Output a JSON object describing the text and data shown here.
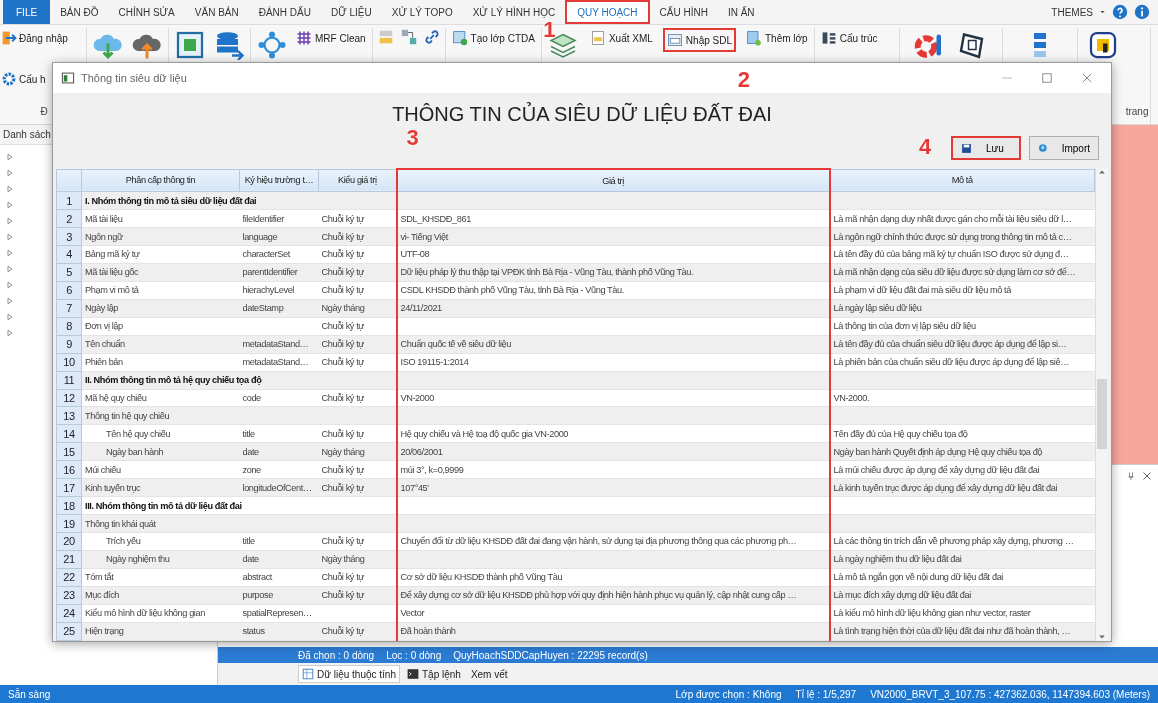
{
  "menu": {
    "tabs": [
      {
        "label": "FILE",
        "kind": "file",
        "selected": false,
        "highlighted": false
      },
      {
        "label": "BẢN ĐỒ",
        "kind": "tab",
        "selected": false,
        "highlighted": false
      },
      {
        "label": "CHỈNH SỬA",
        "kind": "tab",
        "selected": false,
        "highlighted": false
      },
      {
        "label": "VĂN BẢN",
        "kind": "tab",
        "selected": false,
        "highlighted": false
      },
      {
        "label": "ĐÁNH DẤU",
        "kind": "tab",
        "selected": false,
        "highlighted": false
      },
      {
        "label": "DỮ LIỆU",
        "kind": "tab",
        "selected": false,
        "highlighted": false
      },
      {
        "label": "XỬ LÝ TOPO",
        "kind": "tab",
        "selected": false,
        "highlighted": false
      },
      {
        "label": "XỬ LÝ HÌNH HỌC",
        "kind": "tab",
        "selected": false,
        "highlighted": false
      },
      {
        "label": "QUY HOẠCH",
        "kind": "tab",
        "selected": true,
        "highlighted": true,
        "callout": "1"
      },
      {
        "label": "CẤU HÌNH",
        "kind": "tab",
        "selected": false,
        "highlighted": false
      },
      {
        "label": "IN ẤN",
        "kind": "tab",
        "selected": false,
        "highlighted": false
      }
    ],
    "themes": "THEMES"
  },
  "ribbon": {
    "account_buttons": [
      {
        "label": "Đăng nhập"
      },
      {
        "label": "Cấu h"
      }
    ],
    "group_label": "Đ",
    "buttons": [
      {
        "label": "MRF Clean",
        "highlighted": false
      },
      {
        "label": "Tạo lớp CTDA",
        "highlighted": false
      },
      {
        "label": "Xuất XML",
        "highlighted": false
      },
      {
        "label": "Nhập SDL",
        "highlighted": true,
        "callout": "2"
      },
      {
        "label": "Thêm lớp",
        "highlighted": false
      },
      {
        "label": "Cấu trúc",
        "highlighted": false
      }
    ],
    "last_group_label": "trang"
  },
  "left_panel": {
    "title": "Danh sách"
  },
  "dialog": {
    "title": "Thông tin siêu dữ liệu",
    "heading": "THÔNG TIN CỦA SIÊU DỮ LIỆU ĐẤT ĐAI",
    "buttons": [
      {
        "label": "Lưu",
        "kind": "save",
        "highlighted": true,
        "callout": "4"
      },
      {
        "label": "Import",
        "kind": "import",
        "highlighted": false
      }
    ],
    "table": {
      "columns": [
        {
          "label": "Phân cấp thông tin",
          "highlighted": false
        },
        {
          "label": "Ký hiệu trường t…",
          "highlighted": false
        },
        {
          "label": "Kiểu giá trị",
          "highlighted": false
        },
        {
          "label": "Giá trị",
          "highlighted": true,
          "callout": "3"
        },
        {
          "label": "Mô tả",
          "highlighted": false
        }
      ],
      "rows": [
        {
          "number": "1",
          "kind": "group",
          "name": "I. Nhóm thông tin mô tả siêu dữ liệu đất đai"
        },
        {
          "number": "2",
          "kind": "item",
          "name": "Mã tài liệu",
          "field": "fileIdentifier",
          "type": "Chuỗi ký tự",
          "value": "SDL_KHSDĐ_861",
          "description": "Là mã nhận dạng duy nhất được gán cho mỗi tài liệu siêu dữ l…"
        },
        {
          "number": "3",
          "kind": "item",
          "name": "Ngôn ngữ",
          "field": "language",
          "type": "Chuỗi ký tự",
          "value": "vi- Tiếng Việt",
          "description": "Là ngôn ngữ chính thức được sử dụng trong thông tin mô tả c…"
        },
        {
          "number": "4",
          "kind": "item",
          "name": "Bảng mã ký tự",
          "field": "characterSet",
          "type": "Chuỗi ký tự",
          "value": "UTF-08",
          "description": "Là tên đầy đủ của bảng mã ký tự chuẩn ISO được sử dụng đ…"
        },
        {
          "number": "5",
          "kind": "item",
          "name": "Mã tài liệu gốc",
          "field": "parentIdentifier",
          "type": "Chuỗi ký tự",
          "value": "Dữ liệu pháp lý thu thập tại VPĐK tỉnh Bà Rịa - Vũng Tàu, thành phố Vũng Tàu.",
          "description": "Là mã nhận dạng của siêu dữ liệu được sử dụng làm cơ sở để…"
        },
        {
          "number": "6",
          "kind": "item",
          "name": "Phạm vi mô tả",
          "field": "hierachyLevel",
          "type": "Chuỗi ký tự",
          "value": "CSDL KHSDĐ thành phố Vũng Tàu, tỉnh Bà Rịa - Vũng Tàu.",
          "description": "Là phạm vi dữ liệu đất đai mà siêu dữ liệu mô tả"
        },
        {
          "number": "7",
          "kind": "item",
          "name": "Ngày lập",
          "field": "dateStamp",
          "type": "Ngày tháng",
          "value": "24/11/2021",
          "description": "Là ngày lập siêu dữ liệu"
        },
        {
          "number": "8",
          "kind": "item",
          "name": "Đơn vị lập",
          "type": "Chuỗi ký tự",
          "description": "Là thông tin của đơn vị lập siêu dữ liệu"
        },
        {
          "number": "9",
          "kind": "item",
          "name": "Tên chuẩn",
          "field": "metadataStand…",
          "type": "Chuỗi ký tự",
          "value": "Chuẩn quốc tế về siêu dữ liệu",
          "description": "Là tên đầy đủ của chuẩn siêu dữ liệu được áp dụng để lập si…"
        },
        {
          "number": "10",
          "kind": "item",
          "name": "Phiên bản",
          "field": "metadataStand…",
          "type": "Chuỗi ký tự",
          "value": "ISO 19115-1:2014",
          "description": "Là phiên bản của chuẩn siêu dữ liệu được áp dụng để lập siê…"
        },
        {
          "number": "11",
          "kind": "group",
          "name": "II. Nhóm thông tin mô tả hệ quy chiếu tọa độ"
        },
        {
          "number": "12",
          "kind": "item",
          "name": "Mã hệ quy chiếu",
          "field": "code",
          "type": "Chuỗi ký tự",
          "value": "VN-2000",
          "description": "VN-2000."
        },
        {
          "number": "13",
          "kind": "item",
          "name": "Thông tin hệ quy chiếu"
        },
        {
          "number": "14",
          "kind": "subitem",
          "name": "Tên hệ quy chiếu",
          "field": "title",
          "type": "Chuỗi ký tự",
          "value": "Hệ quy chiếu và Hệ toạ độ quốc gia VN-2000",
          "description": "Tên đầy đủ của Hệ quy chiếu tọa độ"
        },
        {
          "number": "15",
          "kind": "subitem",
          "name": "Ngày ban hành",
          "field": "date",
          "type": "Ngày tháng",
          "value": "20/06/2001",
          "description": "Ngày ban hành Quyết định áp dụng Hệ quy chiếu tọa độ"
        },
        {
          "number": "16",
          "kind": "item",
          "name": "Múi chiếu",
          "field": "zone",
          "type": "Chuỗi ký tự",
          "value": "múi 3°, k=0,9999",
          "description": "Là múi chiếu được áp dụng để xây dựng dữ liệu đất đai"
        },
        {
          "number": "17",
          "kind": "item",
          "name": "Kinh tuyến trục",
          "field": "longitudeOfCent…",
          "type": "Chuỗi ký tự",
          "value": "107°45'",
          "description": "Là kinh tuyến trục được áp dụng để xây dựng dữ liệu đất đai"
        },
        {
          "number": "18",
          "kind": "group",
          "name": "III. Nhóm thông tin mô tả dữ liệu đất đai"
        },
        {
          "number": "19",
          "kind": "item",
          "name": "Thông tin khái quát"
        },
        {
          "number": "20",
          "kind": "subitem",
          "name": "Trích yếu",
          "field": "title",
          "type": "Chuỗi ký tự",
          "value": "Chuyển đổi từ dữ liệu KHSDĐ đất đai đang vận hành, sử dụng tại địa phương thông qua các phương ph…",
          "description": "Là các thông tin trích dẫn về phương pháp xây dựng, phương …"
        },
        {
          "number": "21",
          "kind": "subitem",
          "name": "Ngày nghiệm thu",
          "field": "date",
          "type": "Ngày tháng",
          "description": "Là ngày nghiệm thu dữ liệu đất đai"
        },
        {
          "number": "22",
          "kind": "item",
          "name": "Tóm tắt",
          "field": "abstract",
          "type": "Chuỗi ký tự",
          "value": "Cơ sở dữ liệu KHSDĐ thành phố Vũng Tàu",
          "description": "Là mô tả ngắn gọn về nội dung dữ liệu đất đai"
        },
        {
          "number": "23",
          "kind": "item",
          "name": "Mục đích",
          "field": "purpose",
          "type": "Chuỗi ký tự",
          "value": "Để xây dựng cơ sở dữ liệu KHSDĐ phù hợp với quy định hiện hành phục vụ quản lý, cập nhật cung cấp …",
          "description": "Là mục đích xây dựng dữ liệu đất đai"
        },
        {
          "number": "24",
          "kind": "item",
          "name": "Kiểu mô hình dữ liệu không gian",
          "field": "spatialRepresen…",
          "value": "Vector",
          "description": "Là kiểu mô hình dữ liệu không gian như vector, raster"
        },
        {
          "number": "25",
          "kind": "item",
          "name": "Hiện trạng",
          "field": "status",
          "type": "Chuỗi ký tự",
          "value": "Đã hoàn thành",
          "description": "Là tình trạng hiện thời của dữ liệu đất đai như đã hoàn thành, …"
        }
      ]
    }
  },
  "selection_bar": {
    "items": [
      "Đã chọn : 0 dòng",
      "Lọc : 0 dòng",
      "QuyHoachSDDCapHuyen : 22295 record(s)"
    ]
  },
  "bottom_tabs": [
    {
      "label": "Dữ liệu thuộc tính",
      "selected": true
    },
    {
      "label": "Tập lệnh",
      "selected": false
    },
    {
      "label": "Xem vết",
      "selected": false
    }
  ],
  "status_bar": {
    "left": "Sẵn sàng",
    "items": [
      "Lớp được chọn : Không",
      "Tỉ lệ : 1/5,297",
      "VN2000_BRVT_3_107.75 : 427362.036, 1147394.603 (Meters)"
    ]
  }
}
